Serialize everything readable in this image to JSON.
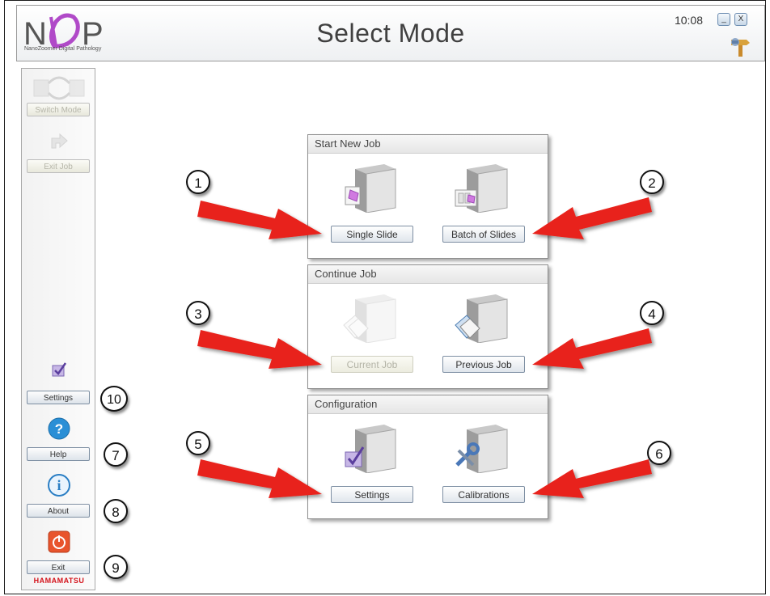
{
  "header": {
    "logo_text": "NDP",
    "logo_subtitle": "NanoZoomer Digital Pathology",
    "title": "Select Mode",
    "clock": "10:08",
    "minimize_label": "_",
    "close_label": "X"
  },
  "sidebar": {
    "switch_mode_label": "Switch Mode",
    "exit_job_label": "Exit Job",
    "settings_label": "Settings",
    "help_label": "Help",
    "about_label": "About",
    "exit_label": "Exit",
    "brand": "HAMAMATSU"
  },
  "panels": {
    "start_new_job": {
      "title": "Start New Job",
      "single_slide_label": "Single Slide",
      "batch_label": "Batch of Slides"
    },
    "continue_job": {
      "title": "Continue Job",
      "current_job_label": "Current Job",
      "previous_job_label": "Previous Job"
    },
    "configuration": {
      "title": "Configuration",
      "settings_label": "Settings",
      "calibrations_label": "Calibrations"
    }
  },
  "callouts": {
    "c1": "1",
    "c2": "2",
    "c3": "3",
    "c4": "4",
    "c5": "5",
    "c6": "6",
    "c7": "7",
    "c8": "8",
    "c9": "9",
    "c10": "10"
  },
  "colors": {
    "arrow": "#e8231a",
    "help_icon": "#2a8fd6",
    "exit_icon": "#e8542c",
    "brand": "#d4141c"
  }
}
